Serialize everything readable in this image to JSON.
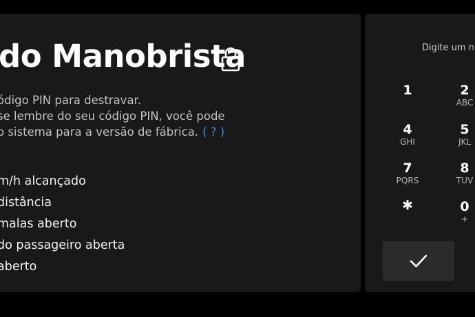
{
  "screen": {
    "title": "do Manobrista",
    "description": [
      "ódigo PIN para destravar.",
      "se lembre do seu código PIN, você pode",
      "o sistema para a versão de fábrica."
    ],
    "help_label": "( ? )",
    "conditions": [
      "m/h alcançado",
      "distância",
      "malas aberto",
      "do passageiro aberta",
      "aberto"
    ]
  },
  "keypad": {
    "prompt": "Digite um n",
    "keys": [
      {
        "digit": "1",
        "letters": ""
      },
      {
        "digit": "2",
        "letters": "ABC"
      },
      {
        "digit": "4",
        "letters": "GHI"
      },
      {
        "digit": "5",
        "letters": "JKL"
      },
      {
        "digit": "7",
        "letters": "PQRS"
      },
      {
        "digit": "8",
        "letters": "TUV"
      },
      {
        "digit": "✱",
        "letters": ""
      },
      {
        "digit": "0",
        "letters": "+"
      }
    ],
    "confirm_icon": "checkmark-icon"
  },
  "icons": {
    "lock": "lock-icon"
  }
}
